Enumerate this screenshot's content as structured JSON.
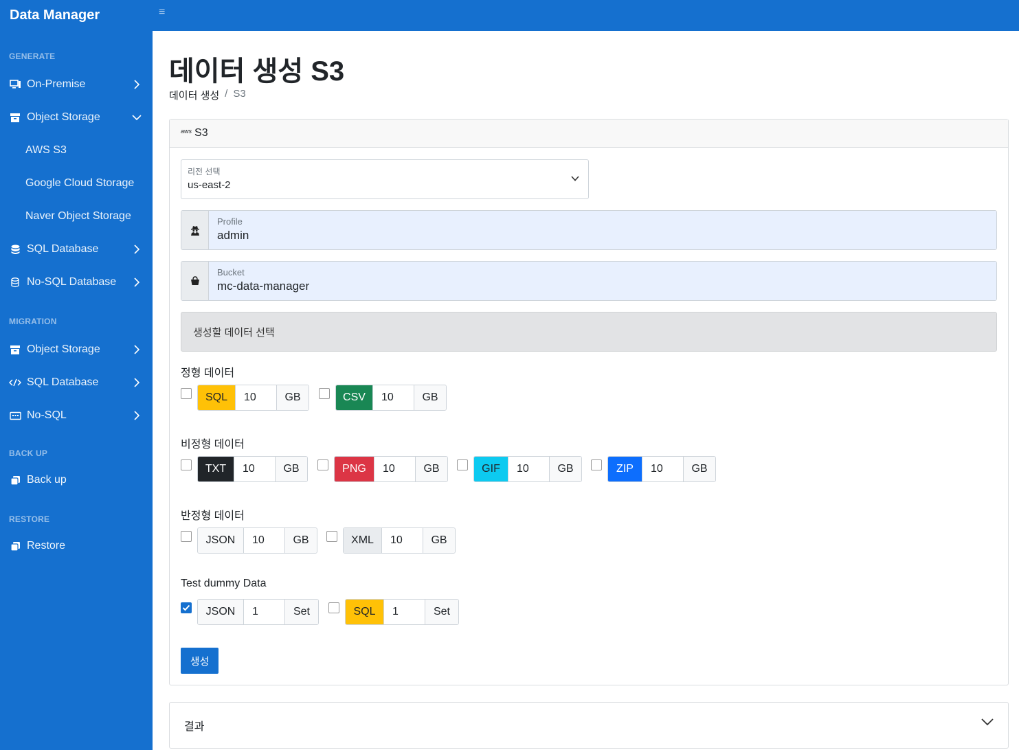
{
  "app": {
    "brand": "Data Manager"
  },
  "sidebar": {
    "sections": [
      {
        "head": "GENERATE"
      },
      {
        "head": "MIGRATION"
      },
      {
        "head": "BACK UP"
      },
      {
        "head": "RESTORE"
      }
    ],
    "generate": {
      "on_premise": "On-Premise",
      "object_storage": "Object Storage",
      "aws_s3": "AWS S3",
      "gcs": "Google Cloud Storage",
      "naver": "Naver Object Storage",
      "sql_db": "SQL Database",
      "nosql_db": "No-SQL Database"
    },
    "migration": {
      "object_storage": "Object Storage",
      "sql_db": "SQL Database",
      "nosql": "No-SQL"
    },
    "backup": {
      "item": "Back up"
    },
    "restore": {
      "item": "Restore"
    }
  },
  "header": {
    "title": "데이터 생성 S3"
  },
  "breadcrumb": {
    "parent": "데이터 생성",
    "sep": "/",
    "current": "S3"
  },
  "card": {
    "header": "S3",
    "aws_logo": "aws",
    "region": {
      "label": "리전 선택",
      "value": "us-east-2"
    },
    "profile": {
      "label": "Profile",
      "value": "admin"
    },
    "bucket": {
      "label": "Bucket",
      "value": "mc-data-manager"
    },
    "select_heading": "생성할 데이터 선택",
    "structured": {
      "label": "정형 데이터",
      "items": [
        {
          "tag": "SQL",
          "value": "10",
          "unit": "GB",
          "checked": false,
          "color": "#ffc107"
        },
        {
          "tag": "CSV",
          "value": "10",
          "unit": "GB",
          "checked": false,
          "color": "#198754"
        }
      ]
    },
    "unstructured": {
      "label": "비정형 데이터",
      "items": [
        {
          "tag": "TXT",
          "value": "10",
          "unit": "GB",
          "checked": false,
          "color": "#212529"
        },
        {
          "tag": "PNG",
          "value": "10",
          "unit": "GB",
          "checked": false,
          "color": "#dc3545"
        },
        {
          "tag": "GIF",
          "value": "10",
          "unit": "GB",
          "checked": false,
          "color": "#0dcaf0"
        },
        {
          "tag": "ZIP",
          "value": "10",
          "unit": "GB",
          "checked": false,
          "color": "#0d6efd"
        }
      ]
    },
    "semistructured": {
      "label": "반정형 데이터",
      "items": [
        {
          "tag": "JSON",
          "value": "10",
          "unit": "GB",
          "checked": false,
          "color": "#f8f9fa"
        },
        {
          "tag": "XML",
          "value": "10",
          "unit": "GB",
          "checked": false,
          "color": "#e9ecef"
        }
      ]
    },
    "dummy": {
      "label": "Test dummy Data",
      "items": [
        {
          "tag": "JSON",
          "value": "1",
          "unit": "Set",
          "checked": true,
          "color": "#f8f9fa"
        },
        {
          "tag": "SQL",
          "value": "1",
          "unit": "Set",
          "checked": false,
          "color": "#ffc107"
        }
      ]
    },
    "submit": "생성"
  },
  "result": {
    "title": "결과"
  },
  "colors": {
    "primary": "#1570cf"
  }
}
